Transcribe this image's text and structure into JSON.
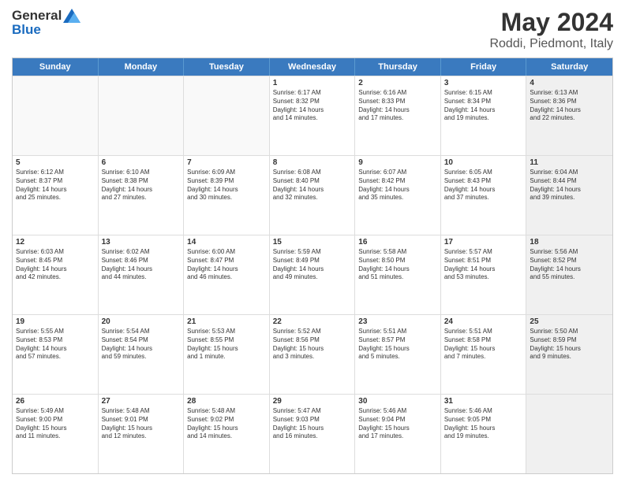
{
  "header": {
    "logo_general": "General",
    "logo_blue": "Blue",
    "title": "May 2024",
    "location": "Roddi, Piedmont, Italy"
  },
  "weekdays": [
    "Sunday",
    "Monday",
    "Tuesday",
    "Wednesday",
    "Thursday",
    "Friday",
    "Saturday"
  ],
  "rows": [
    {
      "cells": [
        {
          "day": "",
          "info": "",
          "shaded": false,
          "empty": true
        },
        {
          "day": "",
          "info": "",
          "shaded": false,
          "empty": true
        },
        {
          "day": "",
          "info": "",
          "shaded": false,
          "empty": true
        },
        {
          "day": "1",
          "info": "Sunrise: 6:17 AM\nSunset: 8:32 PM\nDaylight: 14 hours\nand 14 minutes.",
          "shaded": false,
          "empty": false
        },
        {
          "day": "2",
          "info": "Sunrise: 6:16 AM\nSunset: 8:33 PM\nDaylight: 14 hours\nand 17 minutes.",
          "shaded": false,
          "empty": false
        },
        {
          "day": "3",
          "info": "Sunrise: 6:15 AM\nSunset: 8:34 PM\nDaylight: 14 hours\nand 19 minutes.",
          "shaded": false,
          "empty": false
        },
        {
          "day": "4",
          "info": "Sunrise: 6:13 AM\nSunset: 8:36 PM\nDaylight: 14 hours\nand 22 minutes.",
          "shaded": true,
          "empty": false
        }
      ]
    },
    {
      "cells": [
        {
          "day": "5",
          "info": "Sunrise: 6:12 AM\nSunset: 8:37 PM\nDaylight: 14 hours\nand 25 minutes.",
          "shaded": false,
          "empty": false
        },
        {
          "day": "6",
          "info": "Sunrise: 6:10 AM\nSunset: 8:38 PM\nDaylight: 14 hours\nand 27 minutes.",
          "shaded": false,
          "empty": false
        },
        {
          "day": "7",
          "info": "Sunrise: 6:09 AM\nSunset: 8:39 PM\nDaylight: 14 hours\nand 30 minutes.",
          "shaded": false,
          "empty": false
        },
        {
          "day": "8",
          "info": "Sunrise: 6:08 AM\nSunset: 8:40 PM\nDaylight: 14 hours\nand 32 minutes.",
          "shaded": false,
          "empty": false
        },
        {
          "day": "9",
          "info": "Sunrise: 6:07 AM\nSunset: 8:42 PM\nDaylight: 14 hours\nand 35 minutes.",
          "shaded": false,
          "empty": false
        },
        {
          "day": "10",
          "info": "Sunrise: 6:05 AM\nSunset: 8:43 PM\nDaylight: 14 hours\nand 37 minutes.",
          "shaded": false,
          "empty": false
        },
        {
          "day": "11",
          "info": "Sunrise: 6:04 AM\nSunset: 8:44 PM\nDaylight: 14 hours\nand 39 minutes.",
          "shaded": true,
          "empty": false
        }
      ]
    },
    {
      "cells": [
        {
          "day": "12",
          "info": "Sunrise: 6:03 AM\nSunset: 8:45 PM\nDaylight: 14 hours\nand 42 minutes.",
          "shaded": false,
          "empty": false
        },
        {
          "day": "13",
          "info": "Sunrise: 6:02 AM\nSunset: 8:46 PM\nDaylight: 14 hours\nand 44 minutes.",
          "shaded": false,
          "empty": false
        },
        {
          "day": "14",
          "info": "Sunrise: 6:00 AM\nSunset: 8:47 PM\nDaylight: 14 hours\nand 46 minutes.",
          "shaded": false,
          "empty": false
        },
        {
          "day": "15",
          "info": "Sunrise: 5:59 AM\nSunset: 8:49 PM\nDaylight: 14 hours\nand 49 minutes.",
          "shaded": false,
          "empty": false
        },
        {
          "day": "16",
          "info": "Sunrise: 5:58 AM\nSunset: 8:50 PM\nDaylight: 14 hours\nand 51 minutes.",
          "shaded": false,
          "empty": false
        },
        {
          "day": "17",
          "info": "Sunrise: 5:57 AM\nSunset: 8:51 PM\nDaylight: 14 hours\nand 53 minutes.",
          "shaded": false,
          "empty": false
        },
        {
          "day": "18",
          "info": "Sunrise: 5:56 AM\nSunset: 8:52 PM\nDaylight: 14 hours\nand 55 minutes.",
          "shaded": true,
          "empty": false
        }
      ]
    },
    {
      "cells": [
        {
          "day": "19",
          "info": "Sunrise: 5:55 AM\nSunset: 8:53 PM\nDaylight: 14 hours\nand 57 minutes.",
          "shaded": false,
          "empty": false
        },
        {
          "day": "20",
          "info": "Sunrise: 5:54 AM\nSunset: 8:54 PM\nDaylight: 14 hours\nand 59 minutes.",
          "shaded": false,
          "empty": false
        },
        {
          "day": "21",
          "info": "Sunrise: 5:53 AM\nSunset: 8:55 PM\nDaylight: 15 hours\nand 1 minute.",
          "shaded": false,
          "empty": false
        },
        {
          "day": "22",
          "info": "Sunrise: 5:52 AM\nSunset: 8:56 PM\nDaylight: 15 hours\nand 3 minutes.",
          "shaded": false,
          "empty": false
        },
        {
          "day": "23",
          "info": "Sunrise: 5:51 AM\nSunset: 8:57 PM\nDaylight: 15 hours\nand 5 minutes.",
          "shaded": false,
          "empty": false
        },
        {
          "day": "24",
          "info": "Sunrise: 5:51 AM\nSunset: 8:58 PM\nDaylight: 15 hours\nand 7 minutes.",
          "shaded": false,
          "empty": false
        },
        {
          "day": "25",
          "info": "Sunrise: 5:50 AM\nSunset: 8:59 PM\nDaylight: 15 hours\nand 9 minutes.",
          "shaded": true,
          "empty": false
        }
      ]
    },
    {
      "cells": [
        {
          "day": "26",
          "info": "Sunrise: 5:49 AM\nSunset: 9:00 PM\nDaylight: 15 hours\nand 11 minutes.",
          "shaded": false,
          "empty": false
        },
        {
          "day": "27",
          "info": "Sunrise: 5:48 AM\nSunset: 9:01 PM\nDaylight: 15 hours\nand 12 minutes.",
          "shaded": false,
          "empty": false
        },
        {
          "day": "28",
          "info": "Sunrise: 5:48 AM\nSunset: 9:02 PM\nDaylight: 15 hours\nand 14 minutes.",
          "shaded": false,
          "empty": false
        },
        {
          "day": "29",
          "info": "Sunrise: 5:47 AM\nSunset: 9:03 PM\nDaylight: 15 hours\nand 16 minutes.",
          "shaded": false,
          "empty": false
        },
        {
          "day": "30",
          "info": "Sunrise: 5:46 AM\nSunset: 9:04 PM\nDaylight: 15 hours\nand 17 minutes.",
          "shaded": false,
          "empty": false
        },
        {
          "day": "31",
          "info": "Sunrise: 5:46 AM\nSunset: 9:05 PM\nDaylight: 15 hours\nand 19 minutes.",
          "shaded": false,
          "empty": false
        },
        {
          "day": "",
          "info": "",
          "shaded": true,
          "empty": true
        }
      ]
    }
  ]
}
